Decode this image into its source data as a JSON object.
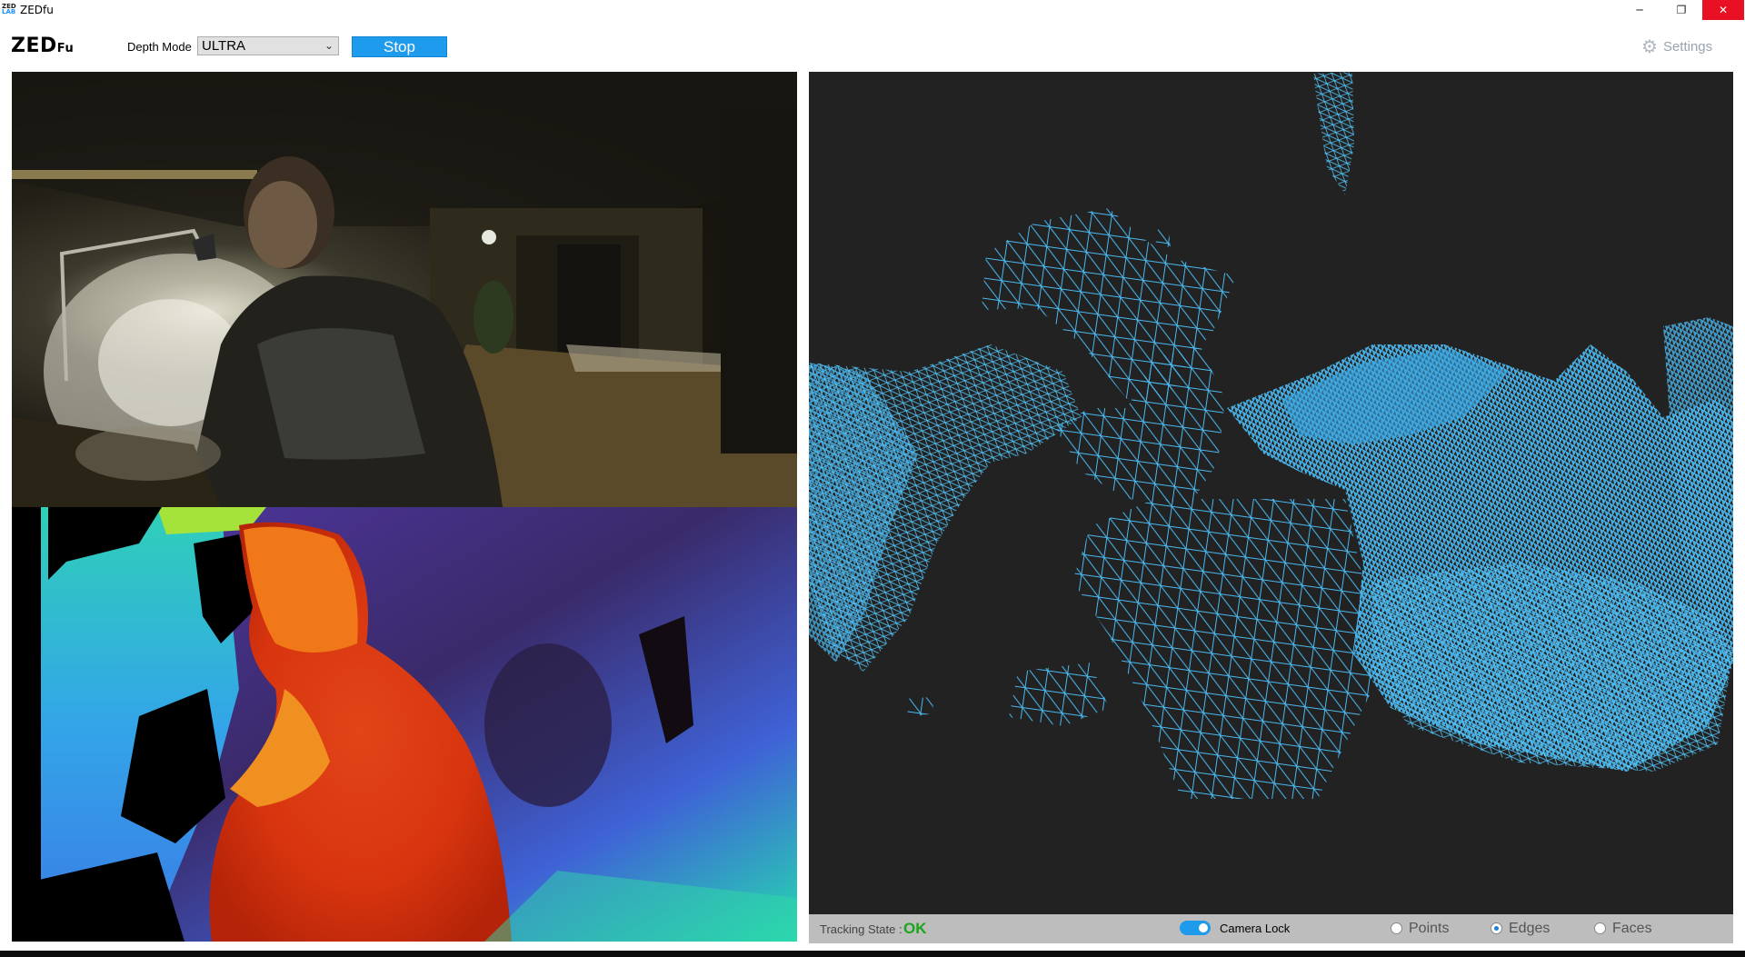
{
  "window": {
    "title": "ZEDfu",
    "icon_text_top": "ZED",
    "icon_text_bottom": "LAB",
    "minimize_glyph": "─",
    "maximize_glyph": "❐",
    "close_glyph": "✕"
  },
  "toolbar": {
    "brand_main": "ZED",
    "brand_sub": "Fu",
    "depth_mode_label": "Depth Mode",
    "depth_mode_value": "ULTRA",
    "stop_label": "Stop",
    "settings_label": "Settings",
    "settings_icon": "gear-icon"
  },
  "status": {
    "tracking_label": "Tracking State :",
    "tracking_value": "OK",
    "camera_lock_label": "Camera Lock",
    "camera_lock_on": true,
    "view_modes": [
      {
        "label": "Points",
        "selected": false
      },
      {
        "label": "Edges",
        "selected": true
      },
      {
        "label": "Faces",
        "selected": false
      }
    ]
  },
  "colors": {
    "accent": "#1e9bec",
    "tracking_ok": "#1aa51a",
    "mesh_edge": "#4ab8f0",
    "viewport_bg": "#222222",
    "close_button": "#e81123"
  }
}
